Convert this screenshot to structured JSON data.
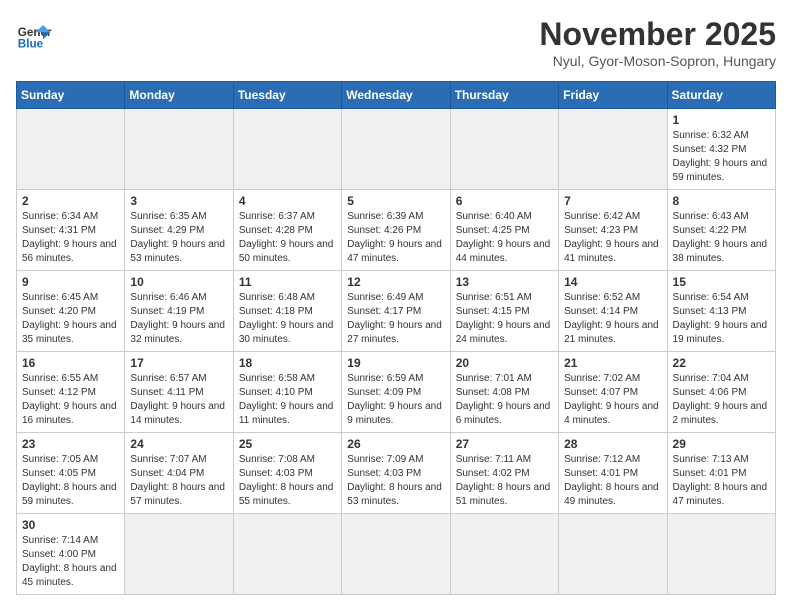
{
  "header": {
    "logo_text_normal": "General",
    "logo_text_blue": "Blue",
    "month_title": "November 2025",
    "location": "Nyul, Gyor-Moson-Sopron, Hungary"
  },
  "days_of_week": [
    "Sunday",
    "Monday",
    "Tuesday",
    "Wednesday",
    "Thursday",
    "Friday",
    "Saturday"
  ],
  "weeks": [
    [
      {
        "day": "",
        "info": ""
      },
      {
        "day": "",
        "info": ""
      },
      {
        "day": "",
        "info": ""
      },
      {
        "day": "",
        "info": ""
      },
      {
        "day": "",
        "info": ""
      },
      {
        "day": "",
        "info": ""
      },
      {
        "day": "1",
        "info": "Sunrise: 6:32 AM\nSunset: 4:32 PM\nDaylight: 9 hours and 59 minutes."
      }
    ],
    [
      {
        "day": "2",
        "info": "Sunrise: 6:34 AM\nSunset: 4:31 PM\nDaylight: 9 hours and 56 minutes."
      },
      {
        "day": "3",
        "info": "Sunrise: 6:35 AM\nSunset: 4:29 PM\nDaylight: 9 hours and 53 minutes."
      },
      {
        "day": "4",
        "info": "Sunrise: 6:37 AM\nSunset: 4:28 PM\nDaylight: 9 hours and 50 minutes."
      },
      {
        "day": "5",
        "info": "Sunrise: 6:39 AM\nSunset: 4:26 PM\nDaylight: 9 hours and 47 minutes."
      },
      {
        "day": "6",
        "info": "Sunrise: 6:40 AM\nSunset: 4:25 PM\nDaylight: 9 hours and 44 minutes."
      },
      {
        "day": "7",
        "info": "Sunrise: 6:42 AM\nSunset: 4:23 PM\nDaylight: 9 hours and 41 minutes."
      },
      {
        "day": "8",
        "info": "Sunrise: 6:43 AM\nSunset: 4:22 PM\nDaylight: 9 hours and 38 minutes."
      }
    ],
    [
      {
        "day": "9",
        "info": "Sunrise: 6:45 AM\nSunset: 4:20 PM\nDaylight: 9 hours and 35 minutes."
      },
      {
        "day": "10",
        "info": "Sunrise: 6:46 AM\nSunset: 4:19 PM\nDaylight: 9 hours and 32 minutes."
      },
      {
        "day": "11",
        "info": "Sunrise: 6:48 AM\nSunset: 4:18 PM\nDaylight: 9 hours and 30 minutes."
      },
      {
        "day": "12",
        "info": "Sunrise: 6:49 AM\nSunset: 4:17 PM\nDaylight: 9 hours and 27 minutes."
      },
      {
        "day": "13",
        "info": "Sunrise: 6:51 AM\nSunset: 4:15 PM\nDaylight: 9 hours and 24 minutes."
      },
      {
        "day": "14",
        "info": "Sunrise: 6:52 AM\nSunset: 4:14 PM\nDaylight: 9 hours and 21 minutes."
      },
      {
        "day": "15",
        "info": "Sunrise: 6:54 AM\nSunset: 4:13 PM\nDaylight: 9 hours and 19 minutes."
      }
    ],
    [
      {
        "day": "16",
        "info": "Sunrise: 6:55 AM\nSunset: 4:12 PM\nDaylight: 9 hours and 16 minutes."
      },
      {
        "day": "17",
        "info": "Sunrise: 6:57 AM\nSunset: 4:11 PM\nDaylight: 9 hours and 14 minutes."
      },
      {
        "day": "18",
        "info": "Sunrise: 6:58 AM\nSunset: 4:10 PM\nDaylight: 9 hours and 11 minutes."
      },
      {
        "day": "19",
        "info": "Sunrise: 6:59 AM\nSunset: 4:09 PM\nDaylight: 9 hours and 9 minutes."
      },
      {
        "day": "20",
        "info": "Sunrise: 7:01 AM\nSunset: 4:08 PM\nDaylight: 9 hours and 6 minutes."
      },
      {
        "day": "21",
        "info": "Sunrise: 7:02 AM\nSunset: 4:07 PM\nDaylight: 9 hours and 4 minutes."
      },
      {
        "day": "22",
        "info": "Sunrise: 7:04 AM\nSunset: 4:06 PM\nDaylight: 9 hours and 2 minutes."
      }
    ],
    [
      {
        "day": "23",
        "info": "Sunrise: 7:05 AM\nSunset: 4:05 PM\nDaylight: 8 hours and 59 minutes."
      },
      {
        "day": "24",
        "info": "Sunrise: 7:07 AM\nSunset: 4:04 PM\nDaylight: 8 hours and 57 minutes."
      },
      {
        "day": "25",
        "info": "Sunrise: 7:08 AM\nSunset: 4:03 PM\nDaylight: 8 hours and 55 minutes."
      },
      {
        "day": "26",
        "info": "Sunrise: 7:09 AM\nSunset: 4:03 PM\nDaylight: 8 hours and 53 minutes."
      },
      {
        "day": "27",
        "info": "Sunrise: 7:11 AM\nSunset: 4:02 PM\nDaylight: 8 hours and 51 minutes."
      },
      {
        "day": "28",
        "info": "Sunrise: 7:12 AM\nSunset: 4:01 PM\nDaylight: 8 hours and 49 minutes."
      },
      {
        "day": "29",
        "info": "Sunrise: 7:13 AM\nSunset: 4:01 PM\nDaylight: 8 hours and 47 minutes."
      }
    ],
    [
      {
        "day": "30",
        "info": "Sunrise: 7:14 AM\nSunset: 4:00 PM\nDaylight: 8 hours and 45 minutes."
      },
      {
        "day": "",
        "info": ""
      },
      {
        "day": "",
        "info": ""
      },
      {
        "day": "",
        "info": ""
      },
      {
        "day": "",
        "info": ""
      },
      {
        "day": "",
        "info": ""
      },
      {
        "day": "",
        "info": ""
      }
    ]
  ]
}
